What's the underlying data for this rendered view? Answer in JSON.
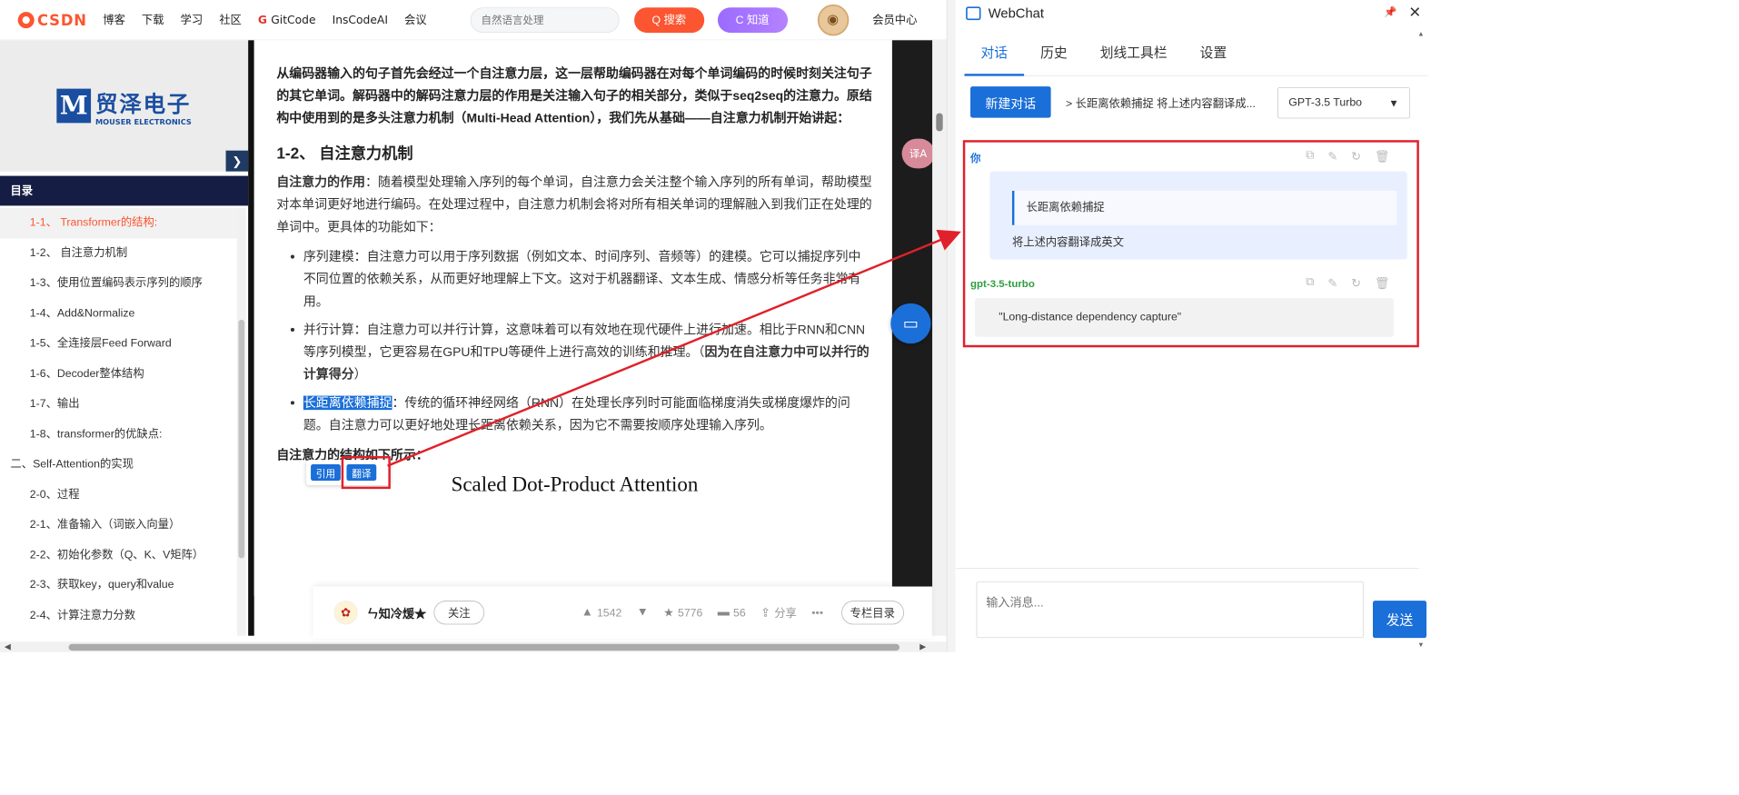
{
  "header": {
    "logo_text": "CSDN",
    "nav": [
      "博客",
      "下载",
      "学习",
      "社区",
      "GitCode",
      "InsCodeAI",
      "会议"
    ],
    "search_placeholder": "自然语言处理",
    "search_button": "Q 搜索",
    "know_button": "C 知道",
    "member_center": "会员中心"
  },
  "sidebar": {
    "ad_brand_cn": "贸泽电子",
    "ad_brand_en": "MOUSER ELECTRONICS",
    "ad_letter": "M",
    "toc_title": "目录",
    "toc": [
      {
        "label": "1-1、 Transformer的结构:",
        "level": 2,
        "active": true
      },
      {
        "label": "1-2、 自注意力机制",
        "level": 2
      },
      {
        "label": "1-3、使用位置编码表示序列的顺序",
        "level": 2
      },
      {
        "label": "1-4、Add&Normalize",
        "level": 2
      },
      {
        "label": "1-5、全连接层Feed Forward",
        "level": 2
      },
      {
        "label": "1-6、Decoder整体结构",
        "level": 2
      },
      {
        "label": "1-7、输出",
        "level": 2
      },
      {
        "label": "1-8、transformer的优缺点:",
        "level": 2
      },
      {
        "label": "二、Self-Attention的实现",
        "level": 1
      },
      {
        "label": "2-0、过程",
        "level": 2
      },
      {
        "label": "2-1、准备输入（词嵌入向量）",
        "level": 2
      },
      {
        "label": "2-2、初始化参数（Q、K、V矩阵）",
        "level": 2
      },
      {
        "label": "2-3、获取key，query和value",
        "level": 2
      },
      {
        "label": "2-4、计算注意力分数",
        "level": 2
      }
    ]
  },
  "article": {
    "intro": "从编码器输入的句子首先会经过一个自注意力层，这一层帮助编码器在对每个单词编码的时候时刻关注句子的其它单词。解码器中的解码注意力层的作用是关注输入句子的相关部分，类似于seq2seq的注意力。原结构中使用到的是多头注意力机制（Multi-Head Attention），我们先从基础——自注意力机制开始讲起：",
    "section_title": "1-2、 自注意力机制",
    "role_label": "自注意力的作用",
    "role_text": "：随着模型处理输入序列的每个单词，自注意力会关注整个输入序列的所有单词，帮助模型对本单词更好地进行编码。在处理过程中，自注意力机制会将对所有相关单词的理解融入到我们正在处理的单词中。更具体的功能如下：",
    "bullet1": "序列建模：自注意力可以用于序列数据（例如文本、时间序列、音频等）的建模。它可以捕捉序列中不同位置的依赖关系，从而更好地理解上下文。这对于机器翻译、文本生成、情感分析等任务非常有用。",
    "bullet2_a": "并行计算：自注意力可以并行计算，这意味着可以有效地在现代硬件上进行加速。相比于RNN和CNN等序列模型，它更容易在GPU和TPU等硬件上进行高效的训练和推理。（",
    "bullet2_b": "因为在自注意力中可以并行的计算得分",
    "bullet2_c": "）",
    "bullet3_hl": "长距离依赖捕捉",
    "bullet3_text": "：传统的循环神经网络（RNN）在处理长序列时可能面临梯度消失或梯度爆炸的问题。自注意力可以更好地处理长距离依赖关系，因为它不需要按顺序处理输入序列。",
    "structure_caption": "自注意力的结构如下所示：",
    "figure_title": "Scaled Dot-Product Attention",
    "tip_quote": "引用",
    "tip_translate": "翻译",
    "translate_fab": "译A"
  },
  "bottom_bar": {
    "author": "ㄣ知冷煖★",
    "follow": "关注",
    "likes": "1542",
    "stars": "5776",
    "comments": "56",
    "share": "分享",
    "more": "•••",
    "column_toc": "专栏目录"
  },
  "webchat": {
    "title": "WebChat",
    "tabs": [
      "对话",
      "历史",
      "划线工具栏",
      "设置"
    ],
    "new_chat": "新建对话",
    "breadcrumb": "> 长距离依赖捕捉 将上述内容翻译成...",
    "model": "GPT-3.5 Turbo",
    "user_role": "你",
    "user_quote": "长距离依赖捕捉",
    "user_text": "将上述内容翻译成英文",
    "assistant_role": "gpt-3.5-turbo",
    "assistant_text": "\"Long-distance dependency capture\"",
    "input_placeholder": "输入消息...",
    "send": "发送",
    "accent": "#1a6fd8",
    "assistant_color": "#2e9e3e"
  }
}
